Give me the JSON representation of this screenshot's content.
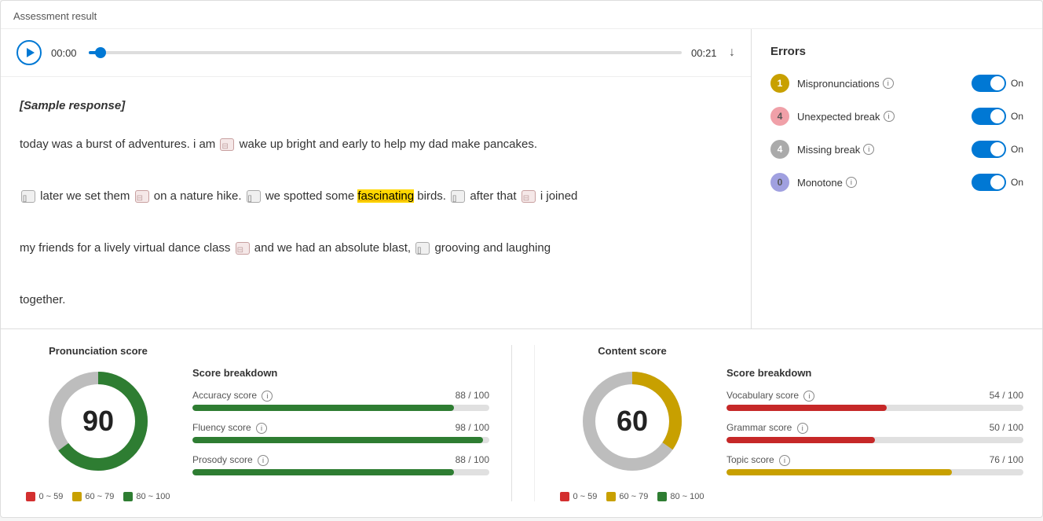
{
  "page": {
    "title": "Assessment result"
  },
  "audio": {
    "time_start": "00:00",
    "time_end": "00:21",
    "progress_percent": 2
  },
  "text_panel": {
    "sample_label": "[Sample response]",
    "text_segments": [
      {
        "type": "normal",
        "content": "today was a burst of adventures. i am "
      },
      {
        "type": "break_pink"
      },
      {
        "type": "normal",
        "content": " wake up bright and early to help my dad make pancakes."
      },
      {
        "type": "newline"
      },
      {
        "type": "break_gray"
      },
      {
        "type": "normal",
        "content": " later we set them "
      },
      {
        "type": "break_pink"
      },
      {
        "type": "normal",
        "content": " on a nature hike. "
      },
      {
        "type": "break_gray"
      },
      {
        "type": "normal",
        "content": " we spotted some "
      },
      {
        "type": "highlight",
        "content": "fascinating"
      },
      {
        "type": "normal",
        "content": " birds. "
      },
      {
        "type": "break_gray"
      },
      {
        "type": "normal",
        "content": " after that "
      },
      {
        "type": "break_pink"
      },
      {
        "type": "normal",
        "content": " i joined"
      },
      {
        "type": "newline"
      },
      {
        "type": "normal",
        "content": "my friends for a lively virtual dance class "
      },
      {
        "type": "break_pink"
      },
      {
        "type": "normal",
        "content": " and we had an absolute blast, "
      },
      {
        "type": "break_gray"
      },
      {
        "type": "normal",
        "content": " grooving and laughing"
      },
      {
        "type": "newline"
      },
      {
        "type": "normal",
        "content": "together."
      }
    ]
  },
  "errors": {
    "title": "Errors",
    "items": [
      {
        "count": "1",
        "label": "Mispronunciations",
        "badge_class": "badge-yellow",
        "toggle_state": "On"
      },
      {
        "count": "4",
        "label": "Unexpected break",
        "badge_class": "badge-pink",
        "toggle_state": "On"
      },
      {
        "count": "4",
        "label": "Missing break",
        "badge_class": "badge-gray",
        "toggle_state": "On"
      },
      {
        "count": "0",
        "label": "Monotone",
        "badge_class": "badge-purple",
        "toggle_state": "On"
      }
    ]
  },
  "pronunciation": {
    "title": "Pronunciation score",
    "score": "90",
    "donut_color": "#2e7d32",
    "donut_gray": "#bdbdbd",
    "donut_percent": 90,
    "legend": [
      {
        "label": "0 ~ 59",
        "color_class": "dot-red"
      },
      {
        "label": "60 ~ 79",
        "color_class": "dot-yellow"
      },
      {
        "label": "80 ~ 100",
        "color_class": "dot-green"
      }
    ],
    "breakdown": {
      "title": "Score breakdown",
      "items": [
        {
          "label": "Accuracy score",
          "value": "88 / 100",
          "percent": 88,
          "color": "#2e7d32"
        },
        {
          "label": "Fluency score",
          "value": "98 / 100",
          "percent": 98,
          "color": "#2e7d32"
        },
        {
          "label": "Prosody score",
          "value": "88 / 100",
          "percent": 88,
          "color": "#2e7d32"
        }
      ]
    }
  },
  "content": {
    "title": "Content score",
    "score": "60",
    "donut_color": "#c8a000",
    "donut_gray": "#bdbdbd",
    "donut_percent": 60,
    "legend": [
      {
        "label": "0 ~ 59",
        "color_class": "dot-red"
      },
      {
        "label": "60 ~ 79",
        "color_class": "dot-yellow"
      },
      {
        "label": "80 ~ 100",
        "color_class": "dot-green"
      }
    ],
    "breakdown": {
      "title": "Score breakdown",
      "items": [
        {
          "label": "Vocabulary score",
          "value": "54 / 100",
          "percent": 54,
          "color": "#c62828"
        },
        {
          "label": "Grammar score",
          "value": "50 / 100",
          "percent": 50,
          "color": "#c62828"
        },
        {
          "label": "Topic score",
          "value": "76 / 100",
          "percent": 76,
          "color": "#c8a000"
        }
      ]
    }
  }
}
